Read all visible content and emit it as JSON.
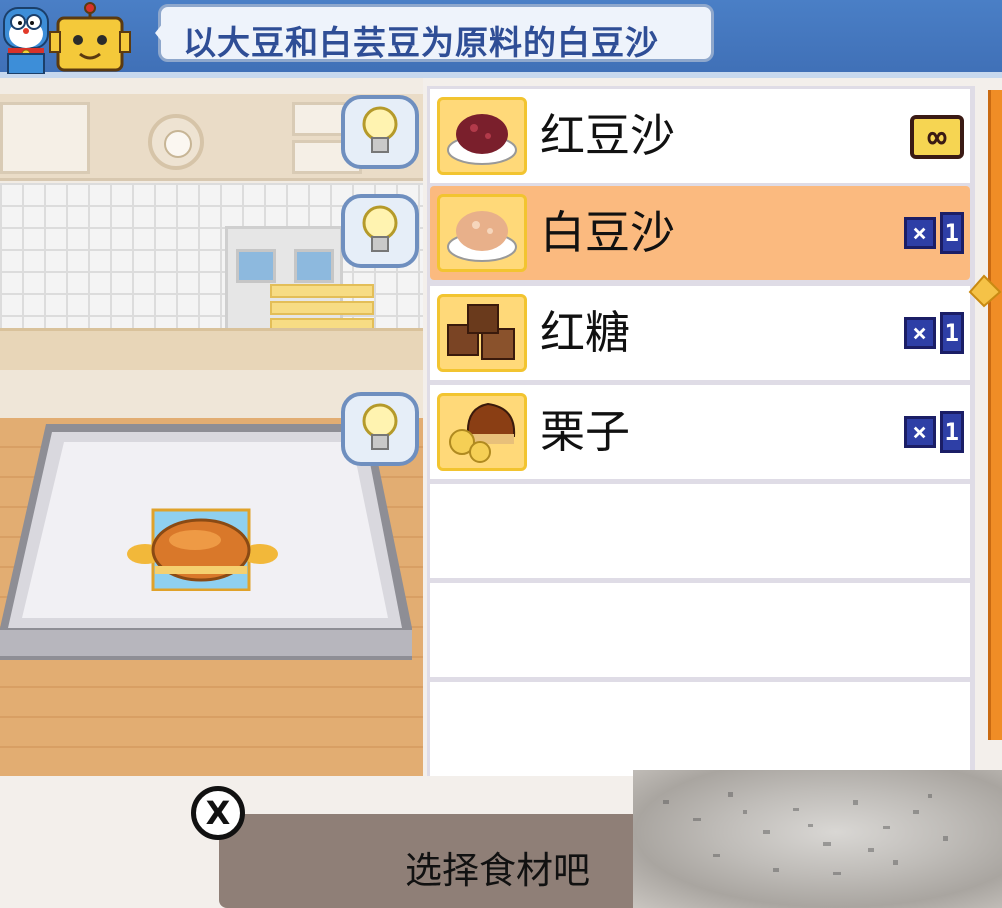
{
  "header": {
    "hint_text": "以大豆和白芸豆为原料的白豆沙",
    "characters": [
      "cat-character-icon",
      "robot-character-icon"
    ]
  },
  "ingredients": [
    {
      "name": "红豆沙",
      "icon": "red-bean-paste-icon",
      "quantity_symbol": "∞",
      "quantity": null,
      "hinted": true,
      "selected": false
    },
    {
      "name": "白豆沙",
      "icon": "white-bean-paste-icon",
      "quantity_symbol": "×",
      "quantity": "1",
      "hinted": true,
      "selected": true
    },
    {
      "name": "红糖",
      "icon": "brown-sugar-icon",
      "quantity_symbol": "×",
      "quantity": "1",
      "hinted": false,
      "selected": false
    },
    {
      "name": "栗子",
      "icon": "chestnut-icon",
      "quantity_symbol": "×",
      "quantity": "1",
      "hinted": true,
      "selected": false
    }
  ],
  "empty_rows": 3,
  "footer": {
    "prompt": "选择食材吧",
    "close_symbol": "X"
  },
  "colors": {
    "banner_blue": "#4a7fc6",
    "hint_text": "#2f4e96",
    "selected_row": "#fbba7f",
    "scrollbar": "#f08d26",
    "quantity_badge": "#2e3fa6"
  }
}
